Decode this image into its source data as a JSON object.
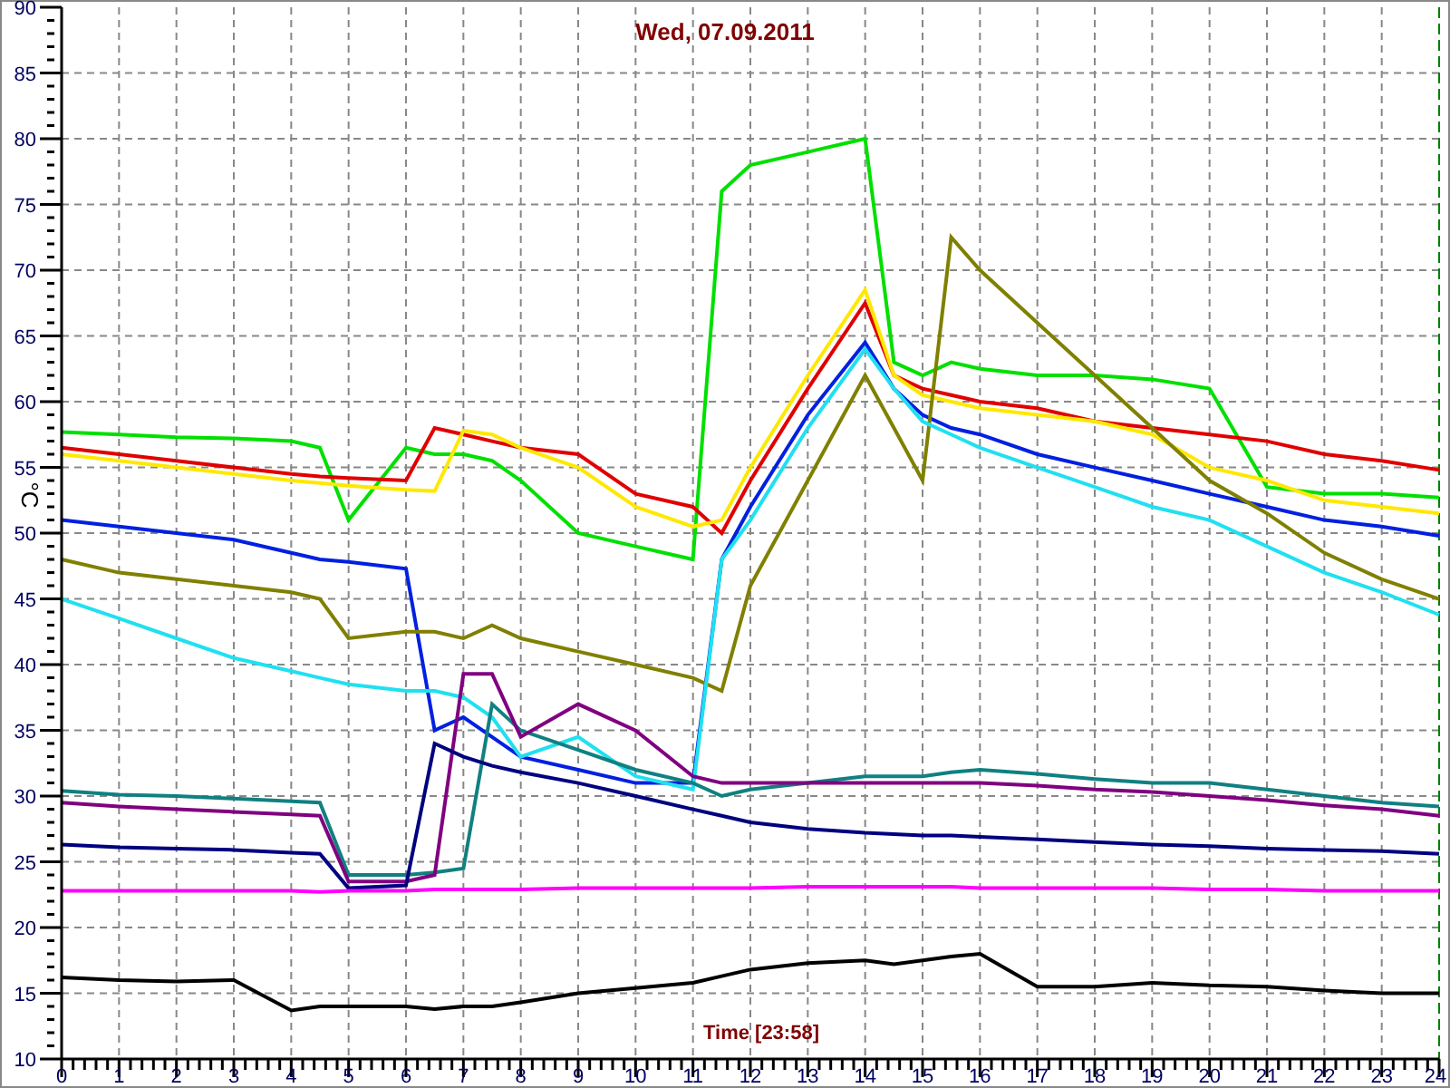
{
  "chart": {
    "chart_data": {
      "type": "line",
      "title": "Wed, 07.09.2011",
      "xlabel": "Time [23:58]",
      "ylabel": "°C",
      "x": [
        0,
        1,
        2,
        3,
        4,
        4.5,
        5,
        6,
        6.5,
        7,
        7.5,
        8,
        9,
        10,
        11,
        11.5,
        12,
        13,
        14,
        14.5,
        15,
        15.5,
        16,
        17,
        18,
        19,
        20,
        21,
        22,
        23,
        24
      ],
      "grid": true,
      "xlim": [
        0,
        24
      ],
      "ylim": [
        10,
        90
      ],
      "xticks": [
        0,
        1,
        2,
        3,
        4,
        5,
        6,
        7,
        8,
        9,
        10,
        11,
        12,
        13,
        14,
        15,
        16,
        17,
        18,
        19,
        20,
        21,
        22,
        23,
        24
      ],
      "yticks": [
        10,
        15,
        20,
        25,
        30,
        35,
        40,
        45,
        50,
        55,
        60,
        65,
        70,
        75,
        80,
        85,
        90
      ],
      "series": [
        {
          "color": "#00e000",
          "values": [
            57.7,
            57.5,
            57.3,
            57.2,
            57,
            56.5,
            51,
            56.5,
            56,
            56,
            55.5,
            54,
            50,
            49,
            48,
            76,
            78,
            79,
            80,
            63,
            62,
            63,
            62.5,
            62,
            62,
            61.7,
            61,
            53.5,
            53,
            53,
            52.7
          ]
        },
        {
          "color": "#e00000",
          "values": [
            56.5,
            56,
            55.5,
            55,
            54.5,
            54.3,
            54.2,
            54,
            58,
            57.5,
            57,
            56.5,
            56,
            53,
            52,
            50,
            54,
            61,
            67.5,
            62,
            61,
            60.5,
            60,
            59.5,
            58.5,
            58,
            57.5,
            57,
            56,
            55.5,
            54.8
          ]
        },
        {
          "color": "#ffe800",
          "values": [
            56,
            55.5,
            55,
            54.5,
            54,
            53.8,
            53.6,
            53.3,
            53.2,
            57.8,
            57.5,
            56.5,
            55,
            52,
            50.5,
            51,
            55,
            62,
            68.5,
            62,
            60.5,
            60,
            59.5,
            59,
            58.5,
            57.5,
            55,
            54,
            52.5,
            52,
            51.5
          ]
        },
        {
          "color": "#0020e0",
          "values": [
            51,
            50.5,
            50,
            49.5,
            48.5,
            48,
            47.8,
            47.3,
            35,
            36,
            34.5,
            33,
            32,
            31,
            31,
            48,
            52,
            59,
            64.5,
            61,
            59,
            58,
            57.5,
            56,
            55,
            54,
            53,
            52,
            51,
            50.5,
            49.8
          ]
        },
        {
          "color": "#808000",
          "values": [
            48,
            47,
            46.5,
            46,
            45.5,
            45,
            42,
            42.5,
            42.5,
            42,
            43,
            42,
            41,
            40,
            39,
            38,
            46,
            54,
            62,
            58,
            54,
            72.5,
            70,
            66,
            62,
            58,
            54,
            51.5,
            48.5,
            46.5,
            45
          ]
        },
        {
          "color": "#20e0f0",
          "values": [
            45,
            43.5,
            42,
            40.5,
            39.5,
            39,
            38.5,
            38,
            38,
            37.5,
            36,
            33,
            34.5,
            31.5,
            30.5,
            48,
            51,
            58,
            64,
            61,
            58.5,
            57.5,
            56.5,
            55,
            53.5,
            52,
            51,
            49,
            47,
            45.5,
            43.8
          ]
        },
        {
          "color": "#108080",
          "values": [
            30.4,
            30.1,
            30,
            29.8,
            29.6,
            29.5,
            24,
            24,
            24.2,
            24.5,
            37,
            35,
            33.5,
            32,
            31,
            30,
            30.5,
            31,
            31.5,
            31.5,
            31.5,
            31.8,
            32,
            31.7,
            31.3,
            31,
            31,
            30.5,
            30,
            29.5,
            29.2
          ]
        },
        {
          "color": "#800080",
          "values": [
            29.5,
            29.2,
            29,
            28.8,
            28.6,
            28.5,
            23.5,
            23.5,
            24,
            39.3,
            39.3,
            34.5,
            37,
            35,
            31.5,
            31,
            31,
            31,
            31,
            31,
            31,
            31,
            31,
            30.8,
            30.5,
            30.3,
            30,
            29.7,
            29.3,
            29,
            28.5
          ]
        },
        {
          "color": "#000080",
          "values": [
            26.3,
            26.1,
            26,
            25.9,
            25.7,
            25.6,
            23,
            23.2,
            34,
            33,
            32.3,
            31.8,
            31,
            30,
            29,
            28.5,
            28,
            27.5,
            27.2,
            27.1,
            27,
            27,
            26.9,
            26.7,
            26.5,
            26.3,
            26.2,
            26,
            25.9,
            25.8,
            25.6
          ]
        },
        {
          "color": "#ff00ff",
          "values": [
            22.8,
            22.8,
            22.8,
            22.8,
            22.8,
            22.7,
            22.8,
            22.8,
            22.9,
            22.9,
            22.9,
            22.9,
            23,
            23,
            23,
            23,
            23,
            23.1,
            23.1,
            23.1,
            23.1,
            23.1,
            23,
            23,
            23,
            23,
            22.9,
            22.9,
            22.8,
            22.8,
            22.8
          ]
        },
        {
          "color": "#000000",
          "values": [
            16.2,
            16,
            15.9,
            16,
            13.7,
            14,
            14,
            14,
            13.8,
            14,
            14,
            14.3,
            15,
            15.4,
            15.8,
            16.3,
            16.8,
            17.3,
            17.5,
            17.2,
            17.5,
            17.8,
            18,
            15.5,
            15.5,
            15.8,
            15.6,
            15.5,
            15.2,
            15,
            15
          ]
        }
      ]
    }
  }
}
